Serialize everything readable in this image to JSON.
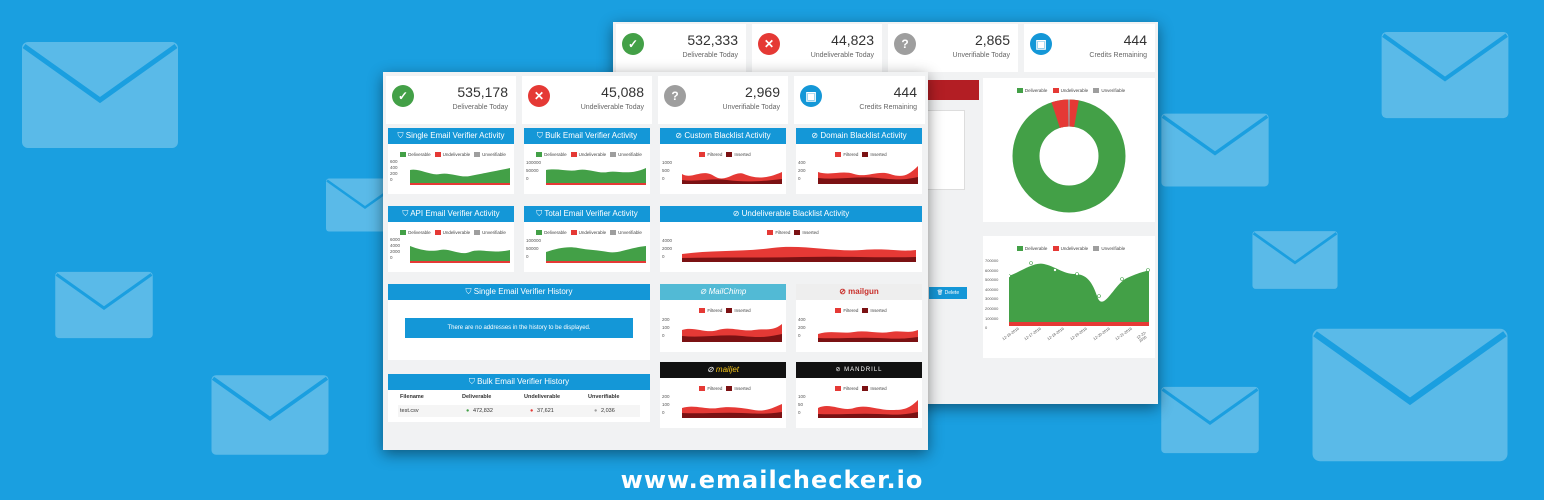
{
  "footer": {
    "url": "www.emailchecker.io"
  },
  "colors": {
    "deliverable": "#43a047",
    "undeliverable": "#e53935",
    "unverifiable": "#9e9e9e",
    "credits": "#1497d7",
    "filtered": "#e53935",
    "inserted": "#7b1113"
  },
  "back_window": {
    "stats": [
      {
        "value": "532,333",
        "label": "Deliverable Today",
        "icon": "check-icon"
      },
      {
        "value": "44,823",
        "label": "Undeliverable Today",
        "icon": "x-icon"
      },
      {
        "value": "2,865",
        "label": "Unverifiable Today",
        "icon": "question-icon"
      },
      {
        "value": "444",
        "label": "Credits Remaining",
        "icon": "credit-icon"
      }
    ],
    "legend": [
      "Deliverable",
      "Undeliverable",
      "Unverifiable"
    ],
    "delete_label": "Delete",
    "line_y_ticks": [
      "700000",
      "600000",
      "500000",
      "400000",
      "300000",
      "200000",
      "100000",
      "0"
    ],
    "line_x_ticks": [
      "12-16-2016",
      "12-17-2016",
      "12-18-2016",
      "12-19-2016",
      "12-20-2016",
      "12-21-2016",
      "12-22-2016"
    ]
  },
  "front_window": {
    "stats": [
      {
        "value": "535,178",
        "label": "Deliverable Today",
        "icon": "check-icon"
      },
      {
        "value": "45,088",
        "label": "Undeliverable Today",
        "icon": "x-icon"
      },
      {
        "value": "2,969",
        "label": "Unverifiable Today",
        "icon": "question-icon"
      },
      {
        "value": "444",
        "label": "Credits Remaining",
        "icon": "credit-icon"
      }
    ],
    "cards": {
      "single": {
        "title": "Single Email Verifier Activity",
        "yticks": [
          "600",
          "400",
          "200",
          "0"
        ]
      },
      "bulk": {
        "title": "Bulk Email Verifier Activity",
        "yticks": [
          "100000",
          "50000",
          "0"
        ]
      },
      "custom": {
        "title": "Custom Blacklist Activity",
        "yticks": [
          "1000",
          "500",
          "0"
        ]
      },
      "domain": {
        "title": "Domain Blacklist Activity",
        "yticks": [
          "400",
          "200",
          "0"
        ]
      },
      "api": {
        "title": "API Email Verifier Activity",
        "yticks": [
          "6000",
          "4000",
          "2000",
          "0"
        ]
      },
      "total": {
        "title": "Total Email Verifier Activity",
        "yticks": [
          "100000",
          "50000",
          "0"
        ]
      },
      "undeliverable": {
        "title": "Undeliverable Blacklist Activity",
        "yticks": [
          "4000",
          "2000",
          "0"
        ]
      },
      "mailchimp": {
        "brand": "MailChimp",
        "yticks": [
          "200",
          "100",
          "0"
        ]
      },
      "mailgun": {
        "brand": "mailgun",
        "yticks": [
          "400",
          "200",
          "0"
        ]
      },
      "mailjet": {
        "brand": "mailjet",
        "yticks": [
          "200",
          "100",
          "0"
        ]
      },
      "mandrill": {
        "brand": "MANDRILL",
        "yticks": [
          "100",
          "50",
          "0"
        ]
      }
    },
    "verifier_legend": [
      "Deliverable",
      "Undeliverable",
      "Unverifiable"
    ],
    "blacklist_legend": [
      "Filtered",
      "Inserted"
    ],
    "single_history": {
      "title": "Single Email Verifier History",
      "notice": "There are no addresses in the history to be displayed."
    },
    "bulk_history": {
      "title": "Bulk Email Verifier History",
      "columns": [
        "Filename",
        "Deliverable",
        "Undeliverable",
        "Unverifiable"
      ],
      "rows": [
        {
          "filename": "test.csv",
          "deliverable": "472,832",
          "undeliverable": "37,621",
          "unverifiable": "2,036"
        }
      ]
    }
  }
}
